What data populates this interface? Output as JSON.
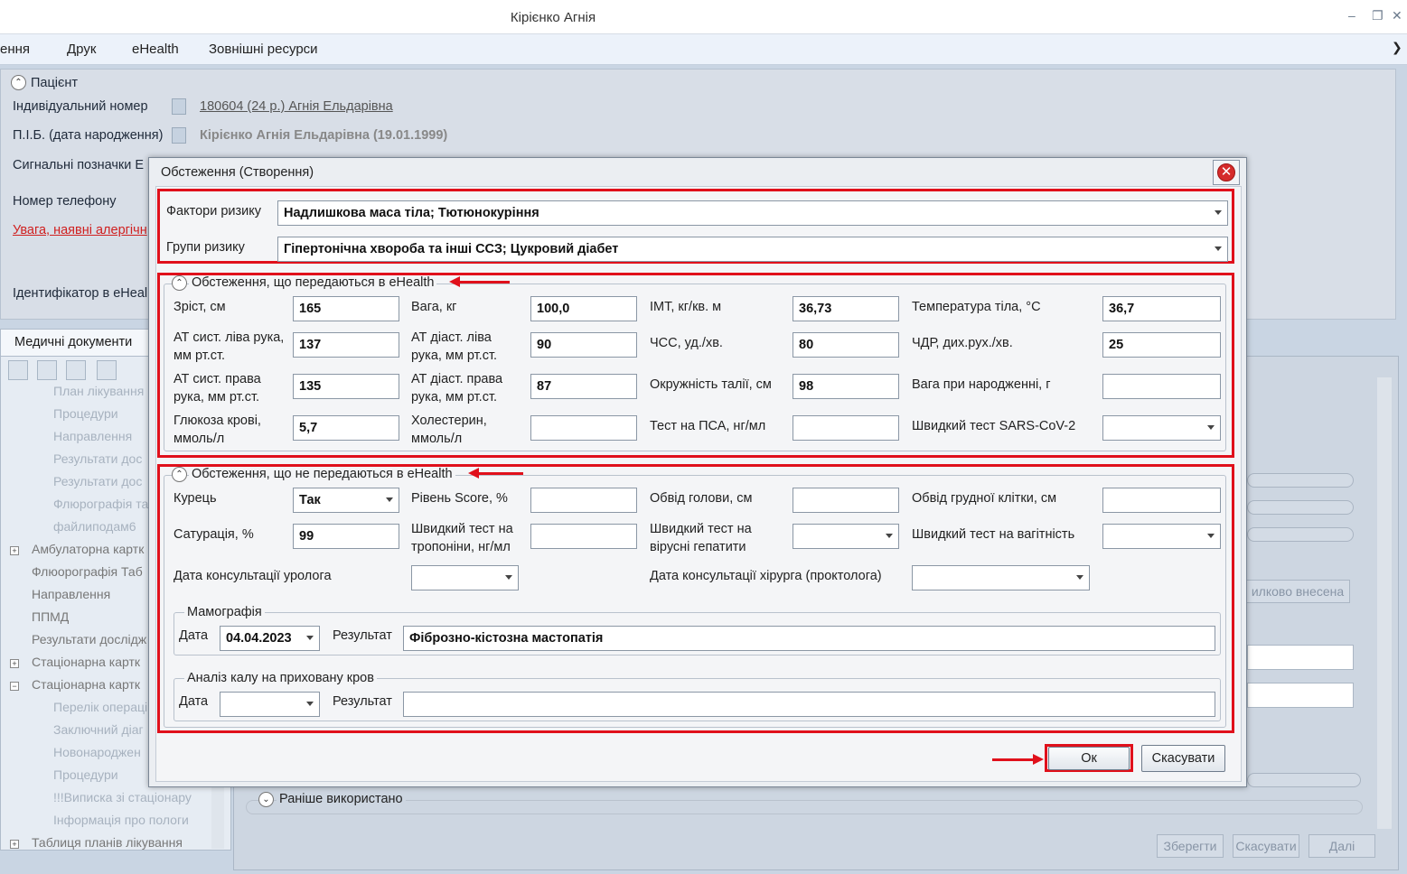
{
  "window": {
    "title": "Кірієнко Агнія"
  },
  "menu": [
    "ення",
    "Друк",
    "eHealth",
    "Зовнішні ресурси"
  ],
  "patient": {
    "section_title": "Пацієнт",
    "id_label": "Індивідуальний номер",
    "id_value": "180604 (24 р.) Агнія Ельдарівна",
    "name_label": "П.І.Б. (дата народження)",
    "name_value": "Кірієнко Агнія Ельдарівна (19.01.1999)",
    "signal_label": "Сигнальні позначки E",
    "phone_label": "Номер телефону",
    "allergy_warning": "Увага, наявні алергічн",
    "ehealth_id_label": "Ідентифікатор в eHeal"
  },
  "left_panel": {
    "tab_label": "Медичні документи",
    "tree": [
      {
        "label": "План лікування",
        "indent": 2,
        "faint": true
      },
      {
        "label": "Процедури",
        "indent": 2,
        "faint": true
      },
      {
        "label": "Направлення",
        "indent": 2,
        "faint": true
      },
      {
        "label": "Результати дос",
        "indent": 2,
        "faint": true
      },
      {
        "label": "Результати дос",
        "indent": 2,
        "faint": true
      },
      {
        "label": "Флюрографія та",
        "indent": 2,
        "faint": true
      },
      {
        "label": "файлиподам6",
        "indent": 2,
        "faint": true
      },
      {
        "label": "Амбулаторна картк",
        "indent": 1,
        "expander": "+"
      },
      {
        "label": "Флюорографія Таб",
        "indent": 1
      },
      {
        "label": "Направлення",
        "indent": 1
      },
      {
        "label": "ППМД",
        "indent": 1
      },
      {
        "label": "Результати дослідж",
        "indent": 1
      },
      {
        "label": "Стаціонарна картк",
        "indent": 1,
        "expander": "+"
      },
      {
        "label": "Стаціонарна картк",
        "indent": 1,
        "expander": "−"
      },
      {
        "label": "Перелік операці",
        "indent": 2,
        "faint": true
      },
      {
        "label": "Заключний діаг",
        "indent": 2,
        "faint": true
      },
      {
        "label": "Новонароджен",
        "indent": 2,
        "faint": true
      },
      {
        "label": "Процедури",
        "indent": 2,
        "faint": true
      },
      {
        "label": "!!!Виписка зі стаціонару",
        "indent": 2,
        "faint": true
      },
      {
        "label": "Інформація про пологи",
        "indent": 2,
        "faint": true
      },
      {
        "label": "Таблиця планів лікування",
        "indent": 1,
        "expander": "+"
      }
    ]
  },
  "right_area": {
    "entered_status": "илково внесена",
    "earlier_used": "Раніше використано",
    "save_button": "Зберегти",
    "cancel_button": "Скасувати",
    "next_button": "Далі"
  },
  "dialog": {
    "title": "Обстеження (Створення)",
    "risk_factors_label": "Фактори ризику",
    "risk_factors_value": "Надлишкова маса тіла; Тютюнокуріння",
    "risk_groups_label": "Групи ризику",
    "risk_groups_value": "Гіпертонічна хвороба та інші ССЗ; Цукровий діабет",
    "ehealth_section": {
      "title": "Обстеження, що передаються в eHealth",
      "height_label": "Зріст, см",
      "height_value": "165",
      "weight_label": "Вага, кг",
      "weight_value": "100,0",
      "bmi_label": "ІМТ, кг/кв. м",
      "bmi_value": "36,73",
      "temp_label": "Температура тіла, °C",
      "temp_value": "36,7",
      "sbp_left_label": "АТ сист. ліва рука, мм рт.ст.",
      "sbp_left_value": "137",
      "dbp_left_label": "АТ діаст. ліва рука, мм рт.ст.",
      "dbp_left_value": "90",
      "hr_label": "ЧСС, уд./хв.",
      "hr_value": "80",
      "rr_label": "ЧДР, дих.рух./хв.",
      "rr_value": "25",
      "sbp_right_label": "АТ сист. права рука, мм рт.ст.",
      "sbp_right_value": "135",
      "dbp_right_label": "АТ діаст. права рука, мм рт.ст.",
      "dbp_right_value": "87",
      "waist_label": "Окружність талії, см",
      "waist_value": "98",
      "birth_weight_label": "Вага при народженні, г",
      "birth_weight_value": "",
      "glucose_label": "Глюкоза крові, ммоль/л",
      "glucose_value": "5,7",
      "cholesterol_label": "Холестерин, ммоль/л",
      "cholesterol_value": "",
      "psa_label": "Тест на ПСА, нг/мл",
      "psa_value": "",
      "sars_label": "Швидкий тест SARS-CoV-2",
      "sars_value": ""
    },
    "local_section": {
      "title": "Обстеження, що не передаються в eHealth",
      "smoker_label": "Курець",
      "smoker_value": "Так",
      "score_label": "Рівень Score, %",
      "score_value": "",
      "head_label": "Обвід голови, см",
      "head_value": "",
      "chest_label": "Обвід грудної клітки, см",
      "chest_value": "",
      "saturation_label": "Сатурація, %",
      "saturation_value": "99",
      "troponin_label": "Швидкий тест на тропоніни, нг/мл",
      "troponin_value": "",
      "hepatitis_label": "Швидкий тест на вірусні гепатити",
      "hepatitis_value": "",
      "pregnancy_label": "Швидкий тест на вагітність",
      "pregnancy_value": "",
      "urologist_label": "Дата консультації уролога",
      "urologist_value": "",
      "surgeon_label": "Дата консультації хірурга (проктолога)",
      "surgeon_value": "",
      "mammography": {
        "title": "Мамографія",
        "date_label": "Дата",
        "date_value": "04.04.2023",
        "result_label": "Результат",
        "result_value": "Фіброзно-кістозна мастопатія"
      },
      "stool_test": {
        "title": "Аналіз калу на приховану кров",
        "date_label": "Дата",
        "date_value": "",
        "result_label": "Результат",
        "result_value": ""
      }
    },
    "ok_button": "Ок",
    "cancel_button": "Скасувати"
  },
  "colors": {
    "highlight": "#e0101b",
    "close_button": "#d52b2b"
  },
  "icons": [
    "minimize-icon",
    "restore-icon",
    "close-icon",
    "chevron-down-icon",
    "collapse-icon",
    "close-icon-red",
    "dropdown-arrow-icon"
  ]
}
